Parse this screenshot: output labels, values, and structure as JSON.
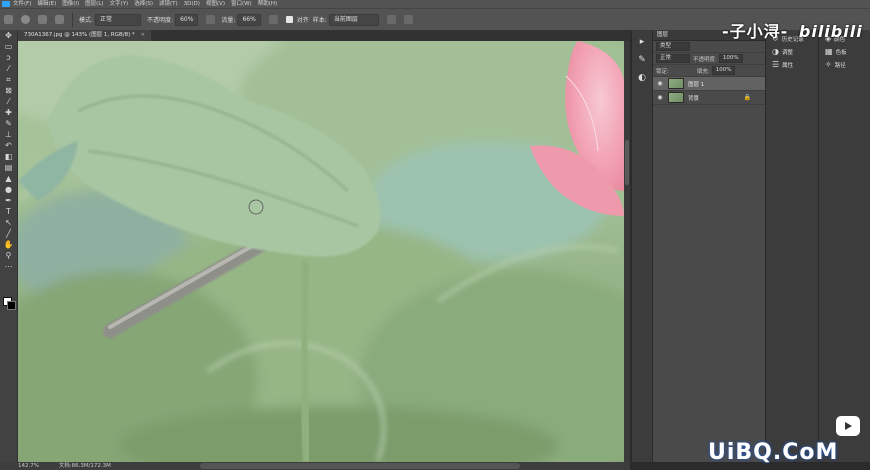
{
  "menubar": {
    "items": [
      "文件(F)",
      "编辑(E)",
      "图像(I)",
      "图层(L)",
      "文字(Y)",
      "选择(S)",
      "滤镜(T)",
      "3D(D)",
      "视图(V)",
      "窗口(W)",
      "帮助(H)"
    ]
  },
  "options": {
    "mode_label": "模式:",
    "mode_value": "正常",
    "opacity_label": "不透明度:",
    "opacity_value": "60%",
    "flow_label": "流量:",
    "flow_value": "66%",
    "align_label": "对齐",
    "sample_label": "样本:",
    "sample_value": "当前图层"
  },
  "document": {
    "tab_title": "730A1367.jpg @ 143% (图层 1, RGB/8) *",
    "close": "×"
  },
  "layers_panel": {
    "tab": "图层",
    "kind_label": "类型",
    "blend": "正常",
    "opacity_label": "不透明度:",
    "opacity": "100%",
    "lock_label": "锁定:",
    "fill_label": "填充:",
    "fill": "100%",
    "layers": [
      {
        "name": "图层 1",
        "active": true
      },
      {
        "name": "背景",
        "active": false,
        "locked": true
      }
    ]
  },
  "right_panels": {
    "col1": [
      "历史记录",
      "调整",
      "属性"
    ],
    "col2": [
      "颜色",
      "色板",
      "路径"
    ]
  },
  "status": {
    "zoom": "142.7%",
    "doc_info": "文档:86.3M/172.3M"
  },
  "overlays": {
    "watermark": "-子小浔-",
    "bili": "bilibili",
    "site": "UiBQ.CoM"
  },
  "colors": {
    "accent": "#2fa3f7",
    "ui_bg": "#535353",
    "panel_bg": "#4a4a4a"
  }
}
